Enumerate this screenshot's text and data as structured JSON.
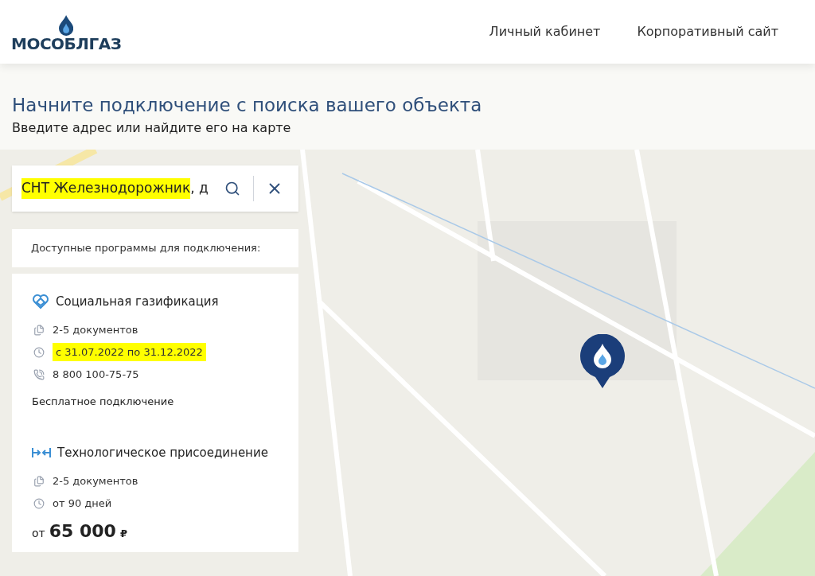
{
  "header": {
    "logo": "МОСОБЛГАЗ",
    "nav": [
      {
        "label": "Личный кабинет"
      },
      {
        "label": "Корпоративный сайт"
      }
    ]
  },
  "intro": {
    "title": "Начните подключение с поиска вашего объекта",
    "subtitle": "Введите адрес или найдите его на карте"
  },
  "search": {
    "value_highlighted": "СНТ Железнодорожник",
    "value_rest": ", д",
    "highlighted": true
  },
  "programs_heading": "Доступные программы для подключения:",
  "programs": [
    {
      "kind": "social",
      "title": "Социальная газификация",
      "details": [
        {
          "kind": "documents",
          "text": "2-5 документов",
          "highlighted": false
        },
        {
          "kind": "period",
          "text": "с 31.07.2022 по 31.12.2022",
          "highlighted": true
        },
        {
          "kind": "phone",
          "text": "8 800 100-75-75",
          "highlighted": false
        }
      ],
      "note": "Бесплатное подключение"
    },
    {
      "kind": "technical",
      "title": "Технологическое присоединение",
      "details": [
        {
          "kind": "documents",
          "text": "2-5 документов",
          "highlighted": false
        },
        {
          "kind": "period",
          "text": "от 90 дней",
          "highlighted": false
        }
      ],
      "price_prefix": "от",
      "price": "65 000",
      "currency": "₽"
    }
  ]
}
